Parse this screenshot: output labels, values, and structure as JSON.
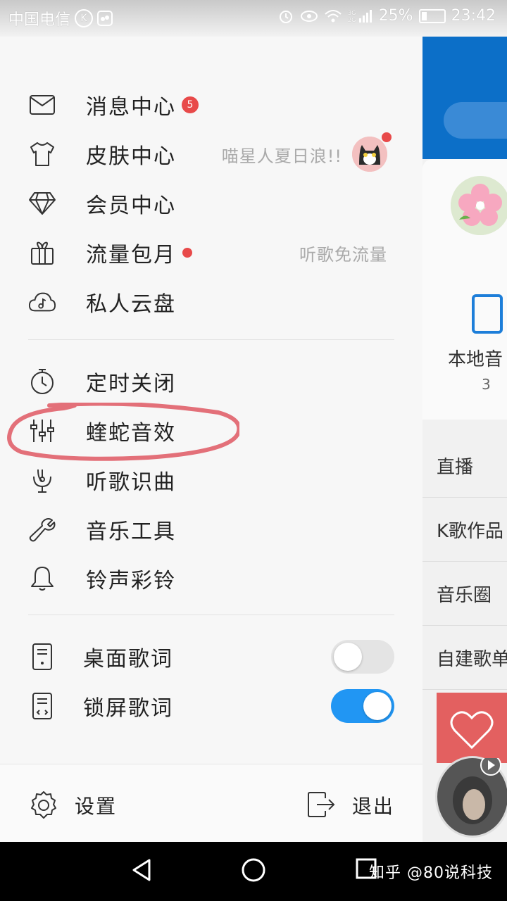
{
  "status_bar": {
    "carrier": "中国电信",
    "k_badge": "K",
    "net_small": "3G\n2G",
    "battery": "25%",
    "time": "23:42"
  },
  "background_app": {
    "local_music_label": "本地音",
    "local_music_count": "3",
    "list_items": [
      "直播",
      "K歌作品",
      "音乐圈",
      "自建歌单"
    ]
  },
  "menu": {
    "section1": [
      {
        "label": "消息中心",
        "icon": "mail-icon",
        "badge": "5"
      },
      {
        "label": "皮肤中心",
        "icon": "tshirt-icon",
        "right_text": "喵星人夏日浪!!"
      },
      {
        "label": "会员中心",
        "icon": "diamond-icon"
      },
      {
        "label": "流量包月",
        "icon": "gift-icon",
        "right_text": "听歌免流量"
      },
      {
        "label": "私人云盘",
        "icon": "cloud-music-icon"
      }
    ],
    "section2": [
      {
        "label": "定时关闭",
        "icon": "timer-icon"
      },
      {
        "label": "蝰蛇音效",
        "icon": "equalizer-icon"
      },
      {
        "label": "听歌识曲",
        "icon": "mic-icon"
      },
      {
        "label": "音乐工具",
        "icon": "wrench-icon"
      },
      {
        "label": "铃声彩铃",
        "icon": "bell-icon"
      }
    ],
    "section3": [
      {
        "label": "桌面歌词",
        "icon": "desktop-lyrics-icon",
        "toggle": "off"
      },
      {
        "label": "锁屏歌词",
        "icon": "lockscreen-lyrics-icon",
        "toggle": "on"
      }
    ]
  },
  "footer": {
    "settings": "设置",
    "logout": "退出"
  },
  "watermark": "知乎 @80说科技",
  "colors": {
    "accent_blue": "#2196f3",
    "badge_red": "#e84a4a",
    "header_blue": "#0c6fc8",
    "annotation_red": "#e0606a"
  }
}
